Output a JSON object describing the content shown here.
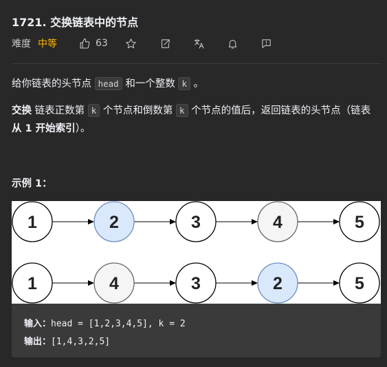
{
  "problem": {
    "title": "1721. 交换链表中的节点",
    "difficulty_label": "难度",
    "difficulty": "中等",
    "likes": "63"
  },
  "description": {
    "p1_a": "给你链表的头节点",
    "p1_code1": "head",
    "p1_b": "和一个整数",
    "p1_code2": "k",
    "p1_c": "。",
    "p2_bold1": "交换",
    "p2_a": "链表正数第",
    "p2_code1": "k",
    "p2_b": "个节点和倒数第",
    "p2_code2": "k",
    "p2_c": "个节点的值后，返回链表的头节点（链表",
    "p2_bold2": "从 1 开始索引",
    "p2_d": "）。"
  },
  "example": {
    "title": "示例 1：",
    "row1": [
      "1",
      "2",
      "3",
      "4",
      "5"
    ],
    "row2": [
      "1",
      "4",
      "3",
      "2",
      "5"
    ],
    "input_label": "输入：",
    "input_value": "head = [1,2,3,4,5], k = 2",
    "output_label": "输出：",
    "output_value": "[1,4,3,2,5]"
  },
  "colors": {
    "highlight_blue": "#dae8fc",
    "highlight_blue_stroke": "#6c8ebf",
    "highlight_gray": "#f5f5f5",
    "highlight_gray_stroke": "#666666",
    "difficulty": "#ffb800"
  }
}
